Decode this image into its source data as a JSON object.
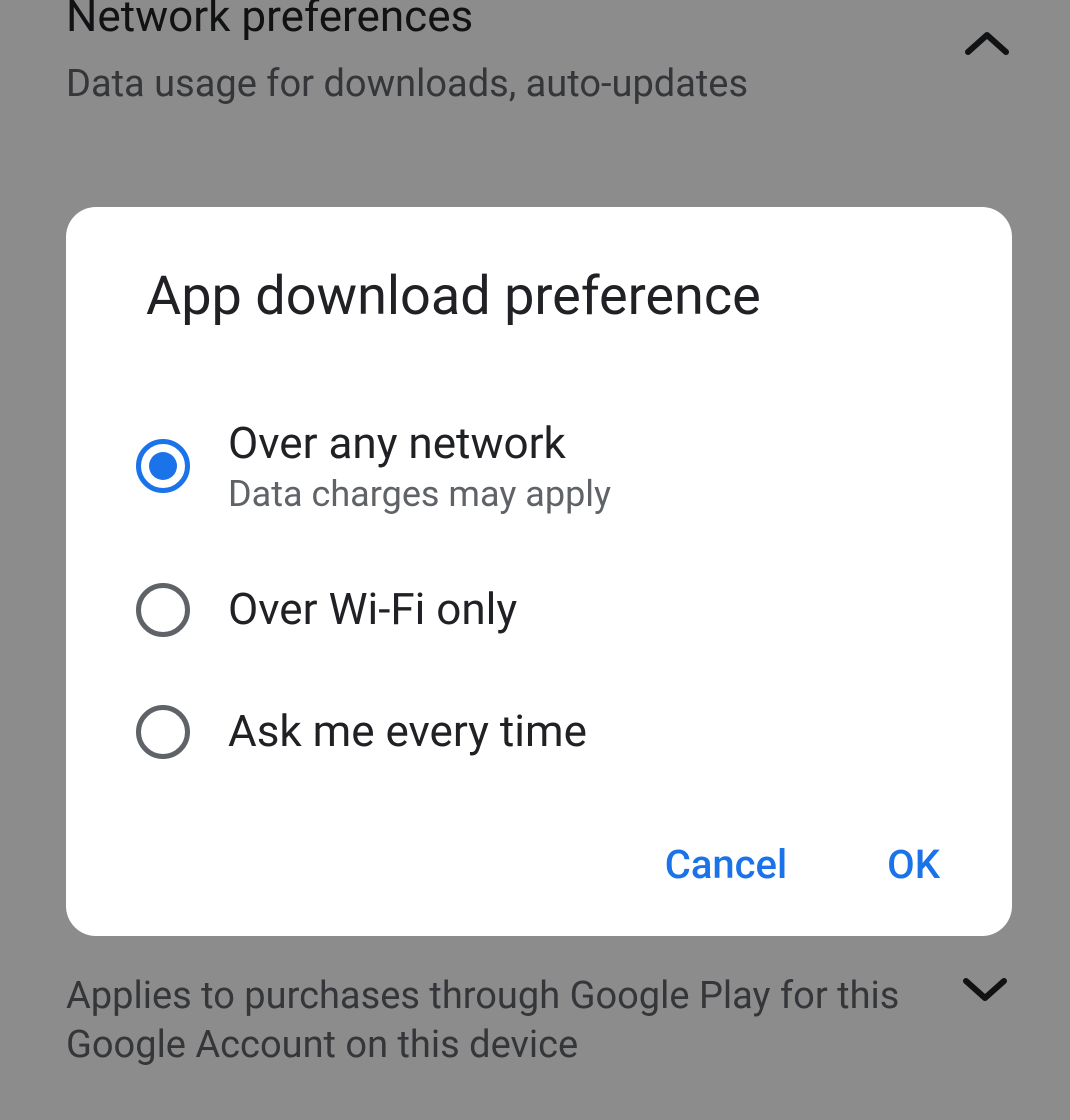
{
  "background": {
    "top": {
      "title": "Network preferences",
      "subtitle": "Data usage for downloads, auto-updates"
    },
    "bottom": {
      "text": "Applies to purchases through Google Play for this Google Account on this device"
    }
  },
  "dialog": {
    "title": "App download preference",
    "options": [
      {
        "label": "Over any network",
        "sublabel": "Data charges may apply",
        "selected": true
      },
      {
        "label": "Over Wi-Fi only",
        "sublabel": "",
        "selected": false
      },
      {
        "label": "Ask me every time",
        "sublabel": "",
        "selected": false
      }
    ],
    "cancel": "Cancel",
    "ok": "OK"
  }
}
